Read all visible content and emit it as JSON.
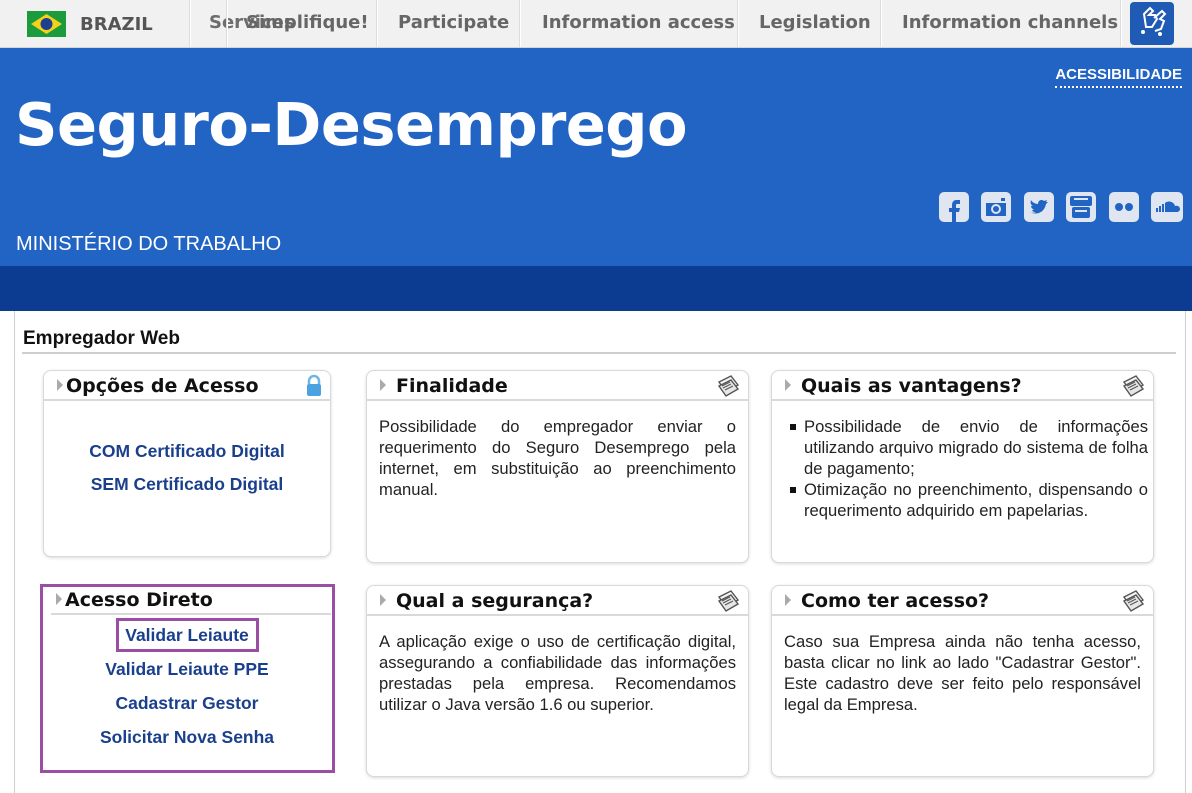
{
  "govbar": {
    "country": "BRAZIL",
    "nav": [
      "Services",
      "Simplifique!",
      "Participate",
      "Information access",
      "Legislation",
      "Information channels"
    ]
  },
  "header": {
    "accessibility": "ACESSIBILIDADE",
    "title": "Seguro-Desemprego",
    "ministry": "MINISTÉRIO DO TRABALHO",
    "social": [
      "facebook-icon",
      "instagram-icon",
      "twitter-icon",
      "youtube-icon",
      "flickr-icon",
      "soundcloud-icon"
    ]
  },
  "section": {
    "title": "Empregador Web"
  },
  "boxes": {
    "opcoes": {
      "title": "Opções de Acesso",
      "links": [
        "COM Certificado Digital",
        "SEM Certificado Digital"
      ]
    },
    "finalidade": {
      "title": "Finalidade",
      "text": "Possibilidade do empregador enviar o requerimento do Seguro Desemprego pela internet, em substituição ao preenchimento manual."
    },
    "vantagens": {
      "title": "Quais as vantagens?",
      "items": [
        "Possibilidade de envio de informações utilizando arquivo migrado do sistema de folha de pagamento;",
        "Otimização no preenchimento, dispensando o requerimento adquirido em papelarias."
      ]
    },
    "acesso_direto": {
      "title": "Acesso Direto",
      "links": [
        "Validar Leiaute",
        "Validar Leiaute PPE",
        "Cadastrar Gestor",
        "Solicitar Nova Senha"
      ]
    },
    "seguranca": {
      "title": "Qual a segurança?",
      "text": "A aplicação exige o uso de certificação digital, assegurando a confiabilidade das informações prestadas pela empresa. Recomendamos utilizar o Java versão 1.6 ou superior."
    },
    "como_acesso": {
      "title": "Como ter acesso?",
      "text": "Caso sua Empresa ainda não tenha acesso, basta clicar no link ao lado \"Cadastrar Gestor\". Este cadastro deve ser feito pelo responsável legal da Empresa."
    }
  },
  "colors": {
    "header_blue": "#2264c4",
    "band_blue": "#0c3c92",
    "link_blue": "#1a3f8c",
    "highlight": "#9a4fa5"
  }
}
